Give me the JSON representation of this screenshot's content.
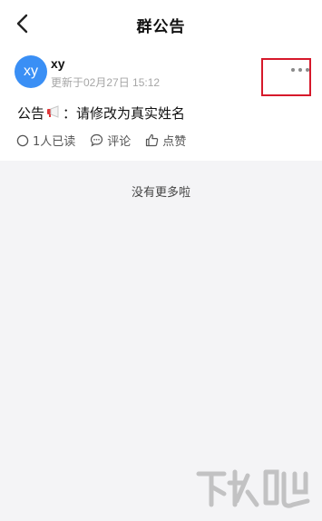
{
  "header": {
    "title": "群公告",
    "back_icon": "back-chevron-icon"
  },
  "post": {
    "avatar_text": "xy",
    "author": "xy",
    "updated": "更新于02月27日 15:12",
    "content_prefix": "公告",
    "content_icon": "megaphone-icon",
    "content_text": "：请修改为真实姓名",
    "more_icon": "more-dots-icon",
    "highlight_color": "#d6192b",
    "avatar_color": "#3a8ff5"
  },
  "actions": {
    "read_label": "1人已读",
    "comment_label": "评论",
    "like_label": "点赞"
  },
  "footer": {
    "no_more_text": "没有更多啦"
  }
}
